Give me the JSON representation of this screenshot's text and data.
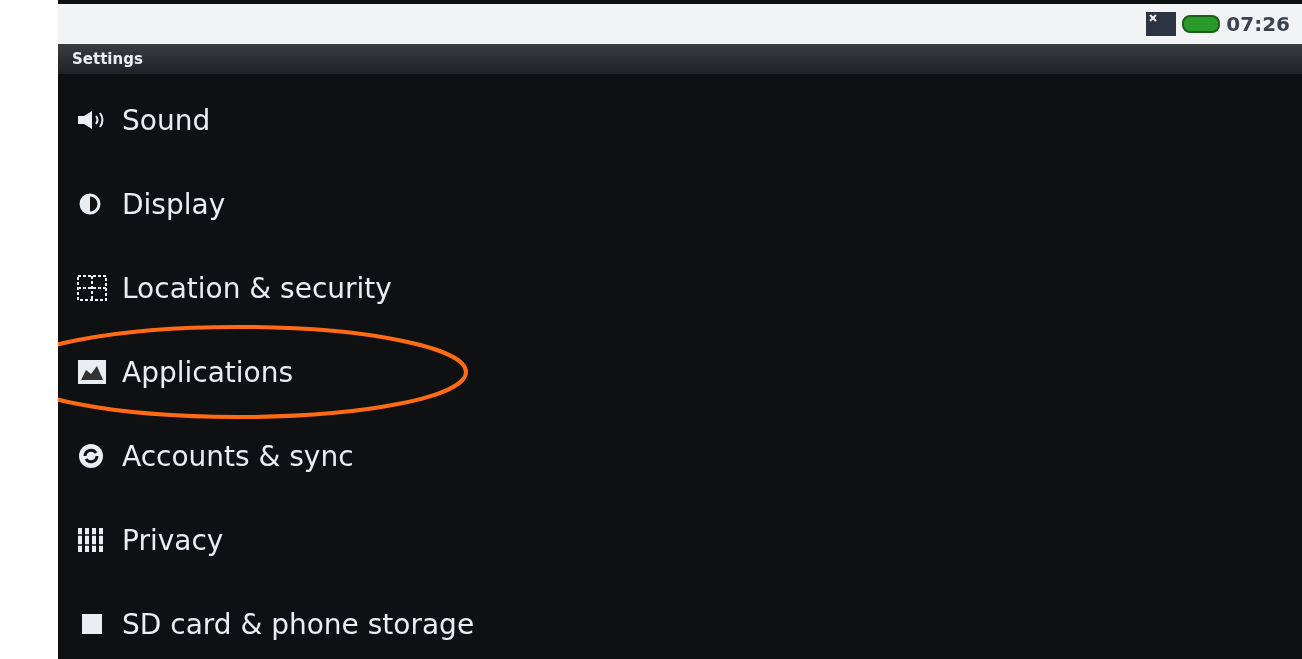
{
  "status_bar": {
    "time": "07:26"
  },
  "title_bar": {
    "title": "Settings"
  },
  "items": [
    {
      "kind": "sound",
      "label": "Sound",
      "highlighted": false
    },
    {
      "kind": "display",
      "label": "Display",
      "highlighted": false
    },
    {
      "kind": "location",
      "label": "Location & security",
      "highlighted": false
    },
    {
      "kind": "applications",
      "label": "Applications",
      "highlighted": true
    },
    {
      "kind": "sync",
      "label": "Accounts & sync",
      "highlighted": false
    },
    {
      "kind": "privacy",
      "label": "Privacy",
      "highlighted": false
    },
    {
      "kind": "storage",
      "label": "SD card & phone storage",
      "highlighted": false
    }
  ]
}
